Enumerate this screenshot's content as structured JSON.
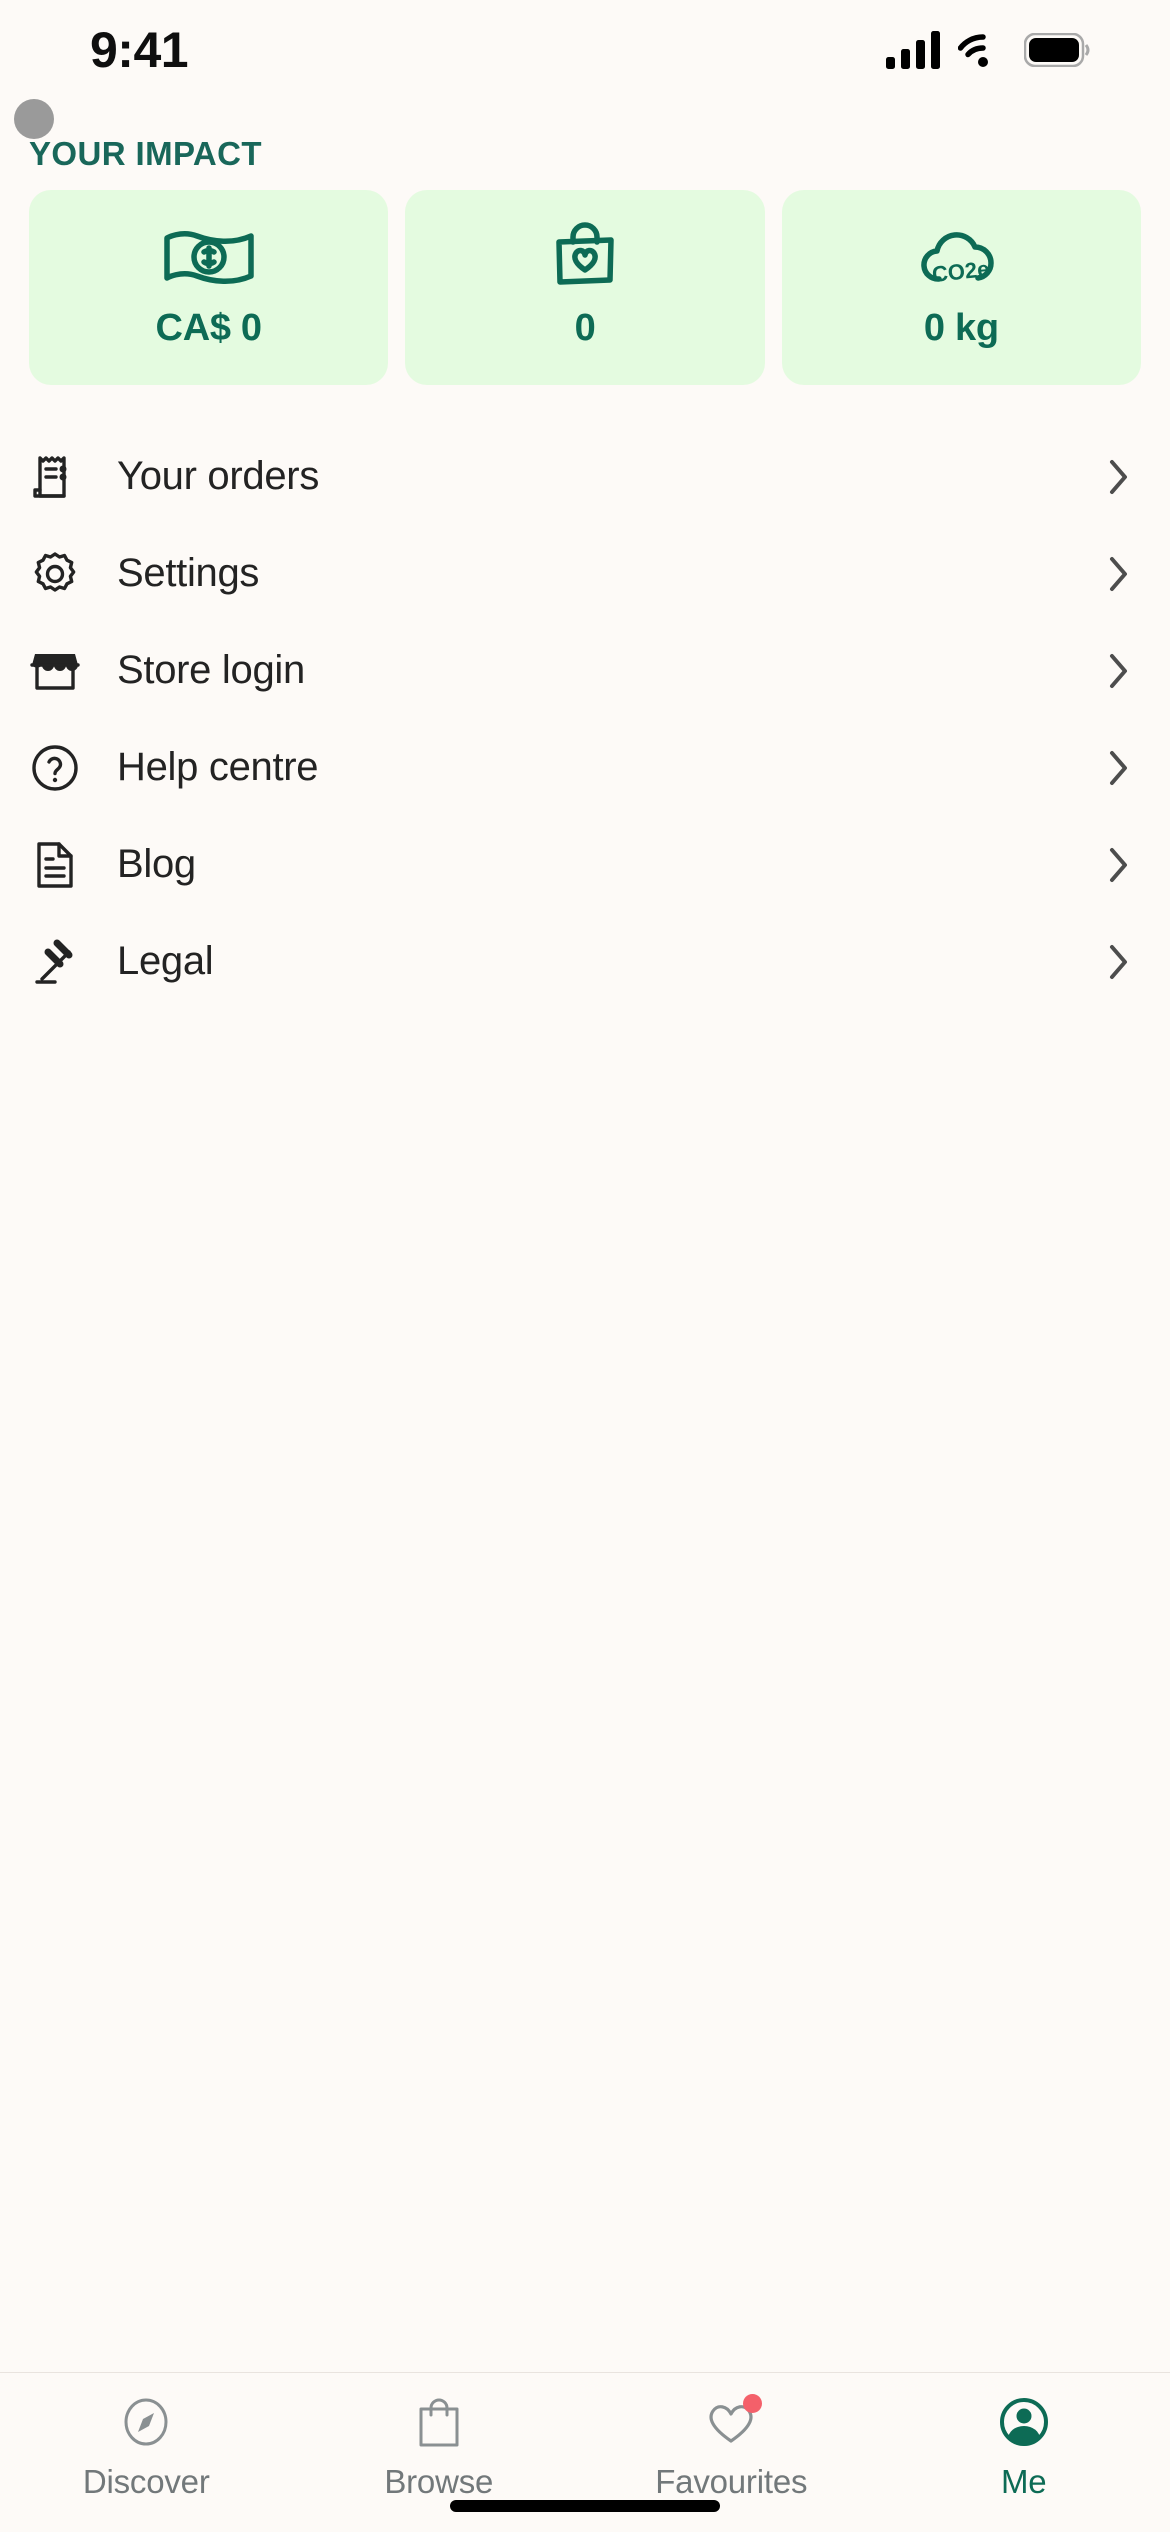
{
  "status_bar": {
    "time": "9:41",
    "cellular_icon": "cellular-signal-icon",
    "wifi_icon": "wifi-icon",
    "battery_icon": "battery-icon"
  },
  "header": {
    "avatar_icon": "avatar-circle",
    "title": "YOUR IMPACT"
  },
  "impact_cards": [
    {
      "icon": "banknote-money-icon",
      "value": "CA$ 0"
    },
    {
      "icon": "shopping-bag-heart-icon",
      "value": "0"
    },
    {
      "icon": "co2e-cloud-icon",
      "value": "0 kg"
    }
  ],
  "menu": {
    "items": [
      {
        "icon": "receipt-icon",
        "label": "Your orders",
        "chevron": "chevron-right-icon"
      },
      {
        "icon": "gear-icon",
        "label": "Settings",
        "chevron": "chevron-right-icon"
      },
      {
        "icon": "storefront-icon",
        "label": "Store login",
        "chevron": "chevron-right-icon"
      },
      {
        "icon": "question-circle-icon",
        "label": "Help centre",
        "chevron": "chevron-right-icon"
      },
      {
        "icon": "document-icon",
        "label": "Blog",
        "chevron": "chevron-right-icon"
      },
      {
        "icon": "gavel-icon",
        "label": "Legal",
        "chevron": "chevron-right-icon"
      }
    ]
  },
  "tab_bar": {
    "tabs": [
      {
        "icon": "compass-icon",
        "label": "Discover",
        "active": false,
        "badge": false
      },
      {
        "icon": "shopping-bag-icon",
        "label": "Browse",
        "active": false,
        "badge": false
      },
      {
        "icon": "heart-icon",
        "label": "Favourites",
        "active": false,
        "badge": true
      },
      {
        "icon": "person-circle-icon",
        "label": "Me",
        "active": true,
        "badge": false
      }
    ]
  },
  "colors": {
    "background": "#fdfaf7",
    "brand_green": "#0d6b55",
    "title_green": "#19675a",
    "card_green_bg": "#e4fbe0",
    "text_dark": "#232323",
    "tab_inactive": "#72787a",
    "badge_red": "#f4606a"
  }
}
